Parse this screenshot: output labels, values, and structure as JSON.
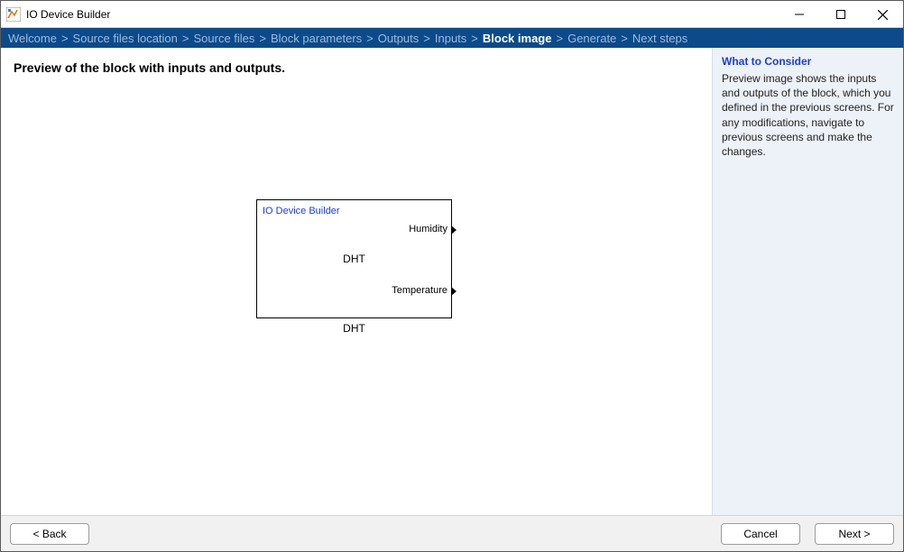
{
  "window": {
    "title": "IO Device Builder"
  },
  "breadcrumb": {
    "items": [
      "Welcome",
      "Source files location",
      "Source files",
      "Block parameters",
      "Outputs",
      "Inputs",
      "Block image",
      "Generate",
      "Next steps"
    ],
    "active_index": 6
  },
  "main": {
    "heading": "Preview of the block with inputs and outputs.",
    "block": {
      "label": "IO Device Builder",
      "center": "DHT",
      "caption": "DHT",
      "ports": [
        "Humidity",
        "Temperature"
      ]
    }
  },
  "sidebar": {
    "title": "What to Consider",
    "text": "Preview image shows the inputs and outputs of the block, which you defined in the previous screens. For any modifications, navigate to previous screens and make the changes."
  },
  "footer": {
    "back": "< Back",
    "cancel": "Cancel",
    "next": "Next >"
  }
}
